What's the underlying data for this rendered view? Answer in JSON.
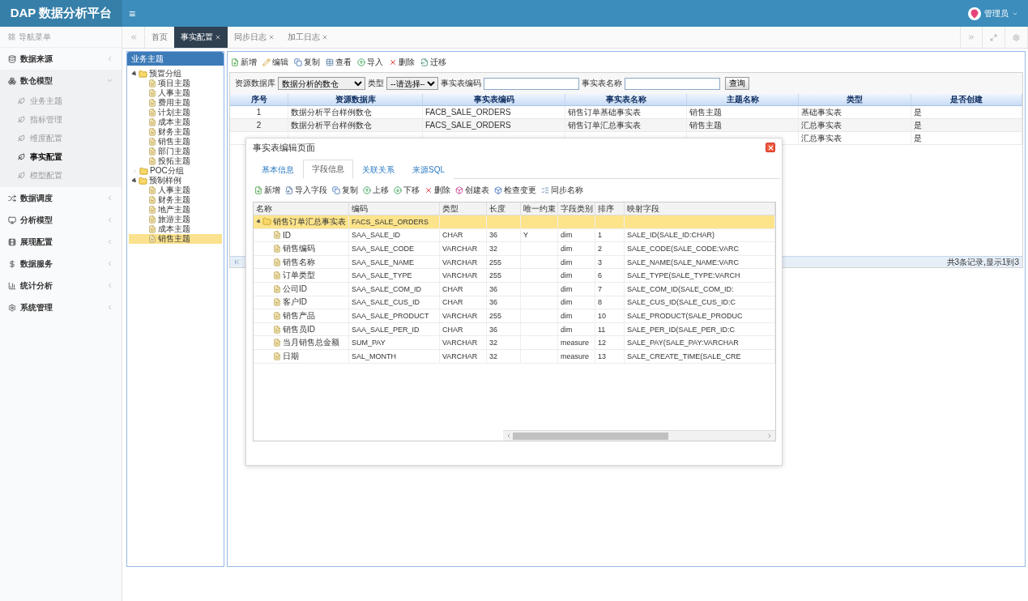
{
  "header": {
    "logo": "DAP 数据分析平台",
    "menu_toggle": "≡",
    "user": "管理员"
  },
  "sidebar": {
    "title": "导航菜单",
    "items": [
      {
        "label": "数据来源",
        "expanded": false
      },
      {
        "label": "数仓模型",
        "expanded": true,
        "children": [
          {
            "label": "业务主题",
            "selected": false
          },
          {
            "label": "指标管理",
            "selected": false
          },
          {
            "label": "维度配置",
            "selected": false
          },
          {
            "label": "事实配置",
            "selected": true
          },
          {
            "label": "模型配置",
            "selected": false
          }
        ]
      },
      {
        "label": "数据调度",
        "expanded": false
      },
      {
        "label": "分析模型",
        "expanded": false
      },
      {
        "label": "展现配置",
        "expanded": false
      },
      {
        "label": "数据服务",
        "expanded": false
      },
      {
        "label": "统计分析",
        "expanded": false
      },
      {
        "label": "系统管理",
        "expanded": false
      }
    ]
  },
  "tabs": [
    {
      "label": "首页",
      "selected": false,
      "closable": false
    },
    {
      "label": "事实配置",
      "selected": true,
      "closable": true
    },
    {
      "label": "同步日志",
      "selected": false,
      "closable": true
    },
    {
      "label": "加工日志",
      "selected": false,
      "closable": true
    }
  ],
  "tree": {
    "title": "业务主题",
    "nodes": [
      {
        "label": "预置分组",
        "expanded": true,
        "children": [
          {
            "label": "项目主题",
            "selected": false
          },
          {
            "label": "人事主题",
            "selected": false
          },
          {
            "label": "费用主题",
            "selected": false
          },
          {
            "label": "计划主题",
            "selected": false
          },
          {
            "label": "成本主题",
            "selected": false
          },
          {
            "label": "财务主题",
            "selected": false
          },
          {
            "label": "销售主题",
            "selected": false
          },
          {
            "label": "部门主题",
            "selected": false
          },
          {
            "label": "投拓主题",
            "selected": false
          }
        ]
      },
      {
        "label": "POC分组",
        "expanded": false
      },
      {
        "label": "预制样例",
        "expanded": true,
        "children": [
          {
            "label": "人事主题",
            "selected": false
          },
          {
            "label": "财务主题",
            "selected": false
          },
          {
            "label": "地产主题",
            "selected": false
          },
          {
            "label": "旅游主题",
            "selected": false
          },
          {
            "label": "成本主题",
            "selected": false
          },
          {
            "label": "销售主题",
            "selected": true
          }
        ]
      }
    ]
  },
  "toolbar": [
    "新增",
    "编辑",
    "复制",
    "查看",
    "导入",
    "删除",
    "迁移"
  ],
  "filters": {
    "db_label": "资源数据库",
    "db_value": "数据分析的数仓",
    "type_label": "类型",
    "type_value": "--请选择--",
    "code_label": "事实表编码",
    "name_label": "事实表名称",
    "search_button": "查询"
  },
  "table": {
    "columns": [
      "序号",
      "资源数据库",
      "事实表编码",
      "事实表名称",
      "主题名称",
      "类型",
      "是否创建"
    ],
    "rows": [
      {
        "index": "1",
        "database": "数据分析平台样例数仓",
        "code": "FACB_SALE_ORDERS",
        "name": "销售订单基础事实表",
        "subject": "销售主题",
        "type": "基础事实表",
        "created": "是"
      },
      {
        "index": "2",
        "database": "数据分析平台样例数仓",
        "code": "FACS_SALE_ORDERS",
        "name": "销售订单汇总事实表",
        "subject": "销售主题",
        "type": "汇总事实表",
        "created": "是"
      },
      {
        "type": "汇总事实表",
        "created": "是"
      }
    ]
  },
  "pager": {
    "text": "共3条记录,显示1到3"
  },
  "dialog": {
    "title": "事实表编辑页面",
    "tabs": [
      {
        "label": "基本信息",
        "selected": false
      },
      {
        "label": "字段信息",
        "selected": true
      },
      {
        "label": "关联关系",
        "selected": false
      },
      {
        "label": "来源SQL",
        "selected": false
      }
    ],
    "toolbar": [
      "新增",
      "导入字段",
      "复制",
      "上移",
      "下移",
      "删除",
      "创建表",
      "检查变更",
      "同步名称"
    ],
    "columns": [
      "名称",
      "编码",
      "类型",
      "长度",
      "唯一约束",
      "字段类别",
      "排序",
      "映射字段"
    ],
    "rows": [
      {
        "name": "销售订单汇总事实表",
        "code": "FACS_SALE_ORDERS",
        "selected": true,
        "expanded": true,
        "children": [
          {
            "name": "ID",
            "code": "SAA_SALE_ID",
            "type": "CHAR",
            "length": "36",
            "unique": "Y",
            "category": "dim",
            "order": "1",
            "mapping": "SALE_ID(SALE_ID:CHAR)",
            "selected": false
          },
          {
            "name": "销售编码",
            "code": "SAA_SALE_CODE",
            "type": "VARCHAR",
            "length": "32",
            "category": "dim",
            "order": "2",
            "mapping": "SALE_CODE(SALE_CODE:VARC",
            "selected": false
          },
          {
            "name": "销售名称",
            "code": "SAA_SALE_NAME",
            "type": "VARCHAR",
            "length": "255",
            "category": "dim",
            "order": "3",
            "mapping": "SALE_NAME(SALE_NAME:VARC",
            "selected": false
          },
          {
            "name": "订单类型",
            "code": "SAA_SALE_TYPE",
            "type": "VARCHAR",
            "length": "255",
            "category": "dim",
            "order": "6",
            "mapping": "SALE_TYPE(SALE_TYPE:VARCH",
            "selected": false
          },
          {
            "name": "公司ID",
            "code": "SAA_SALE_COM_ID",
            "type": "CHAR",
            "length": "36",
            "category": "dim",
            "order": "7",
            "mapping": "SALE_COM_ID(SALE_COM_ID:",
            "selected": false
          },
          {
            "name": "客户ID",
            "code": "SAA_SALE_CUS_ID",
            "type": "CHAR",
            "length": "36",
            "category": "dim",
            "order": "8",
            "mapping": "SALE_CUS_ID(SALE_CUS_ID:C",
            "selected": false
          },
          {
            "name": "销售产品",
            "code": "SAA_SALE_PRODUCT",
            "type": "VARCHAR",
            "length": "255",
            "category": "dim",
            "order": "10",
            "mapping": "SALE_PRODUCT(SALE_PRODUC",
            "selected": false
          },
          {
            "name": "销售员ID",
            "code": "SAA_SALE_PER_ID",
            "type": "CHAR",
            "length": "36",
            "category": "dim",
            "order": "11",
            "mapping": "SALE_PER_ID(SALE_PER_ID:C",
            "selected": false
          },
          {
            "name": "当月销售总金额",
            "code": "SUM_PAY",
            "type": "VARCHAR",
            "length": "32",
            "category": "measure",
            "order": "12",
            "mapping": "SALE_PAY(SALE_PAY:VARCHAR",
            "selected": false
          },
          {
            "name": "日期",
            "code": "SAL_MONTH",
            "type": "VARCHAR",
            "length": "32",
            "category": "measure",
            "order": "13",
            "mapping": "SALE_CREATE_TIME(SALE_CRE",
            "selected": false
          }
        ]
      }
    ]
  }
}
